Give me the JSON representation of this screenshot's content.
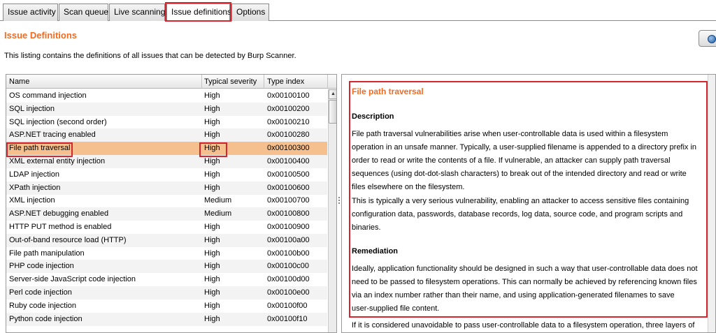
{
  "tabs": [
    {
      "label": "Issue activity"
    },
    {
      "label": "Scan queue"
    },
    {
      "label": "Live scanning"
    },
    {
      "label": "Issue definitions",
      "selected": true
    },
    {
      "label": "Options"
    }
  ],
  "page": {
    "heading": "Issue Definitions",
    "intro": "This listing contains the definitions of all issues that can be detected by Burp Scanner."
  },
  "table": {
    "columns": [
      "Name",
      "Typical severity",
      "Type index"
    ],
    "selected_index": 4,
    "rows": [
      {
        "name": "OS command injection",
        "severity": "High",
        "type": "0x00100100"
      },
      {
        "name": "SQL injection",
        "severity": "High",
        "type": "0x00100200"
      },
      {
        "name": "SQL injection (second order)",
        "severity": "High",
        "type": "0x00100210"
      },
      {
        "name": "ASP.NET tracing enabled",
        "severity": "High",
        "type": "0x00100280"
      },
      {
        "name": "File path traversal",
        "severity": "High",
        "type": "0x00100300"
      },
      {
        "name": "XML external entity injection",
        "severity": "High",
        "type": "0x00100400"
      },
      {
        "name": "LDAP injection",
        "severity": "High",
        "type": "0x00100500"
      },
      {
        "name": "XPath injection",
        "severity": "High",
        "type": "0x00100600"
      },
      {
        "name": "XML injection",
        "severity": "Medium",
        "type": "0x00100700"
      },
      {
        "name": "ASP.NET debugging enabled",
        "severity": "Medium",
        "type": "0x00100800"
      },
      {
        "name": "HTTP PUT method is enabled",
        "severity": "High",
        "type": "0x00100900"
      },
      {
        "name": "Out-of-band resource load (HTTP)",
        "severity": "High",
        "type": "0x00100a00"
      },
      {
        "name": "File path manipulation",
        "severity": "High",
        "type": "0x00100b00"
      },
      {
        "name": "PHP code injection",
        "severity": "High",
        "type": "0x00100c00"
      },
      {
        "name": "Server-side JavaScript code injection",
        "severity": "High",
        "type": "0x00100d00"
      },
      {
        "name": "Perl code injection",
        "severity": "High",
        "type": "0x00100e00"
      },
      {
        "name": "Ruby code injection",
        "severity": "High",
        "type": "0x00100f00"
      },
      {
        "name": "Python code injection",
        "severity": "High",
        "type": "0x00100f10"
      }
    ]
  },
  "detail": {
    "title": "File path traversal",
    "description_heading": "Description",
    "description_p1": [
      "File path traversal vulnerabilities arise when user-controllable data is used within a filesystem",
      "operation in an unsafe manner. Typically, a user-supplied filename is appended to a directory prefix in",
      "order to read or write the contents of a file. If vulnerable, an attacker can supply path traversal",
      "sequences (using dot-dot-slash characters) to break out of the intended directory and read or write",
      "files elsewhere on the filesystem."
    ],
    "description_p2": [
      "This is typically a very serious vulnerability, enabling an attacker to access sensitive files containing",
      "configuration data, passwords, database records, log data, source code, and program scripts and",
      "binaries."
    ],
    "remediation_heading": "Remediation",
    "remediation_p1": [
      "Ideally, application functionality should be designed in such a way that user-controllable data does not",
      "need to be passed to filesystem operations. This can normally be achieved by referencing known files",
      "via an index number rather than their name, and using application-generated filenames to save",
      "user-supplied file content."
    ],
    "remediation_p2_partial": "If it is considered unavoidable to pass user-controllable data to a filesystem operation, three layers of"
  },
  "colors": {
    "accent": "#f26b21",
    "highlight_box": "#d4262e",
    "selected_row": "#f6c08e"
  },
  "icons": {
    "top_right_button": "globe-icon"
  }
}
